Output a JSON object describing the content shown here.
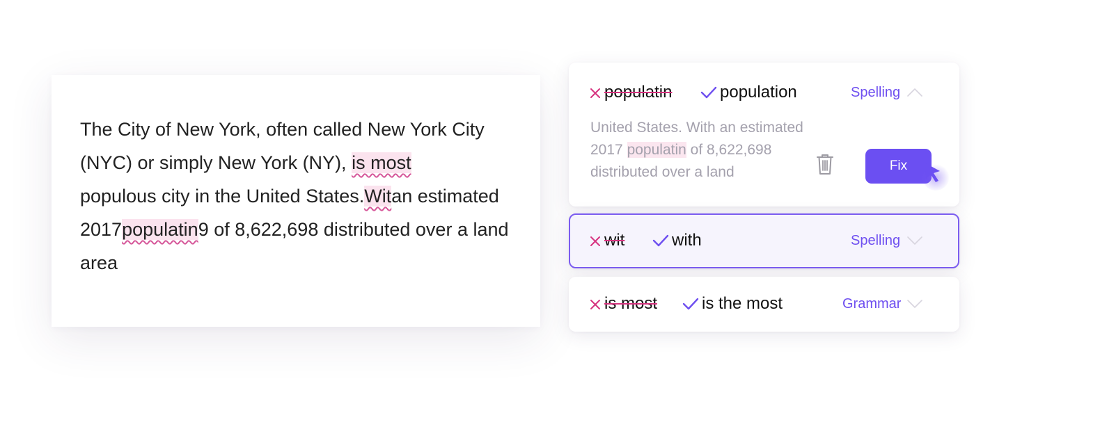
{
  "document": {
    "parts": [
      "The City of New York, often called New York City (NYC) or simply New York (NY), ",
      "is most",
      " populous city in the United States.",
      "Wit",
      "an estimated 2017",
      "populatin",
      "9 of 8,622,698 distributed over a land area"
    ]
  },
  "suggestions": [
    {
      "wrong": "populatin",
      "correct": "population",
      "category": "Spelling",
      "expanded": true,
      "preview": {
        "before": "United States. With an estimated 2017 ",
        "highlight": "populatin",
        "after": " of 8,622,698 distributed over a land"
      },
      "delete_icon": "trash-icon",
      "fix_label": "Fix"
    },
    {
      "wrong": "wit",
      "correct": "with",
      "category": "Spelling",
      "expanded": false,
      "selected": true
    },
    {
      "wrong": "is most",
      "correct": "is the most",
      "category": "Grammar",
      "expanded": false
    }
  ],
  "colors": {
    "accent": "#6e4ff0",
    "error": "#d6337f",
    "highlight": "#fbe3ee",
    "selected_bg": "#f6f4fd"
  }
}
